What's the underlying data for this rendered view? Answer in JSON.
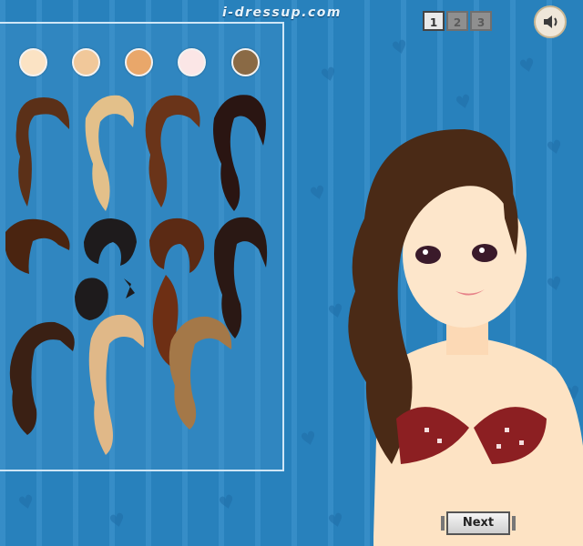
{
  "site": {
    "logo_text": "i-dressup.com"
  },
  "skin_tones": [
    {
      "name": "fair",
      "color": "#fbe3c4"
    },
    {
      "name": "light",
      "color": "#f1c89a"
    },
    {
      "name": "tan",
      "color": "#e9a76a"
    },
    {
      "name": "pale-pink",
      "color": "#fbe6e6"
    },
    {
      "name": "brown",
      "color": "#8a6a45"
    }
  ],
  "pager": {
    "pages": [
      "1",
      "2",
      "3"
    ],
    "current": "1"
  },
  "sound": {
    "icon": "speaker-icon"
  },
  "next_button": {
    "label": "Next"
  },
  "colors": {
    "background": "#2a86c4",
    "panel_border": "#cfe6f6",
    "hair_dark": "#4a2a16",
    "hair_blonde": "#e3c08a",
    "hair_black": "#1e1b1c",
    "bikini": "#8c1f22"
  }
}
